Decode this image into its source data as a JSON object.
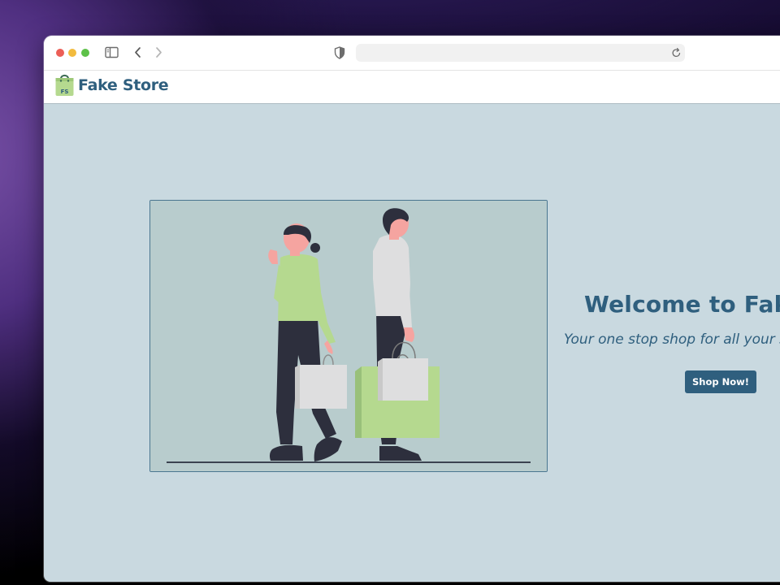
{
  "browser": {
    "address_bar_value": "",
    "icons": {
      "sidebar": "sidebar-icon",
      "back": "chevron-left-icon",
      "forward": "chevron-right-icon",
      "privacy": "shield-icon",
      "reload": "reload-icon"
    }
  },
  "site": {
    "brand_name": "Fake Store",
    "logo_badge": "FS"
  },
  "hero": {
    "title": "Welcome to Fake",
    "subtitle": "Your one stop shop for all your s",
    "cta_label": "Shop Now!"
  },
  "colors": {
    "brand_primary": "#2f5f7e",
    "page_background": "#c9d9e0",
    "illustration_background": "#b8cccd",
    "accent_green": "#b5d98f"
  }
}
